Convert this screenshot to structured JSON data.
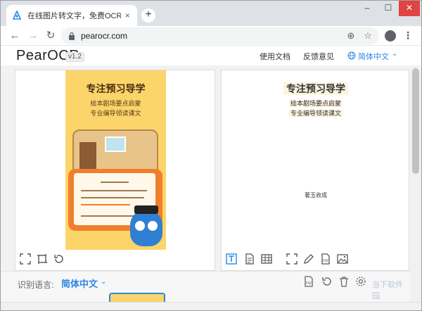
{
  "browser": {
    "tab_title": "在线图片转文字，免费OCR，在",
    "new_tab": "+",
    "close_tab": "×",
    "url": "pearocr.com",
    "window_controls": [
      "–",
      "☐",
      "✕"
    ]
  },
  "app": {
    "logo": "PearOCR",
    "version": "v1.2",
    "links": [
      "使用文档",
      "反馈意见"
    ],
    "language": "简体中文"
  },
  "poster": {
    "title": "专注预习导学",
    "lines": [
      "绘本剧场要点启蒙",
      "专业编导领读课文"
    ]
  },
  "result": {
    "title": "专注预习导学",
    "lines": [
      "绘本剧场要点启蒙",
      "专业编导领读课文"
    ],
    "caption": "著玉收成"
  },
  "bottom": {
    "label": "识别语言:",
    "language": "简体中文",
    "watermark": "当下软件园"
  },
  "colors": {
    "accent": "#2b87e3",
    "poster_bg": "#fbd46a"
  }
}
